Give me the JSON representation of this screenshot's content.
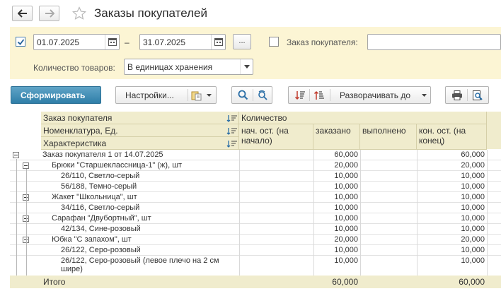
{
  "window": {
    "title": "Заказы покупателей"
  },
  "filters": {
    "period_enabled": true,
    "date_from": "01.07.2025",
    "date_dash": "–",
    "date_to": "31.07.2025",
    "period_button": "...",
    "order_enabled": false,
    "order_label": "Заказ покупателя:",
    "order_value": "",
    "qty_label": "Количество товаров:",
    "qty_value": "В единицах хранения"
  },
  "toolbar": {
    "generate": "Сформировать",
    "settings": "Настройки...",
    "expand": "Разворачивать до"
  },
  "report": {
    "headers": {
      "group1": "Заказ покупателя",
      "group2": "Номенклатура, Ед.",
      "group3": "Характеристика",
      "quantity": "Количество",
      "start_1": "нач. ост. (на",
      "start_2": "начало)",
      "ordered": "заказано",
      "done": "выполнено",
      "end_1": "кон. ост. (на",
      "end_2": "конец)"
    },
    "rows": [
      {
        "name": "Заказ покупателя 1 от 14.07.2025",
        "start": "",
        "ordered": "60,000",
        "done": "",
        "end": "60,000"
      },
      {
        "name": "Брюки \"Старшеклассница-1\" (ж), шт",
        "start": "",
        "ordered": "20,000",
        "done": "",
        "end": "20,000"
      },
      {
        "name": "26/110, Светло-серый",
        "start": "",
        "ordered": "10,000",
        "done": "",
        "end": "10,000"
      },
      {
        "name": "56/188, Темно-серый",
        "start": "",
        "ordered": "10,000",
        "done": "",
        "end": "10,000"
      },
      {
        "name": "Жакет \"Школьница\", шт",
        "start": "",
        "ordered": "10,000",
        "done": "",
        "end": "10,000"
      },
      {
        "name": "34/116, Светло-серый",
        "start": "",
        "ordered": "10,000",
        "done": "",
        "end": "10,000"
      },
      {
        "name": "Сарафан \"Двубортный\", шт",
        "start": "",
        "ordered": "10,000",
        "done": "",
        "end": "10,000"
      },
      {
        "name": "42/134, Сине-розовый",
        "start": "",
        "ordered": "10,000",
        "done": "",
        "end": "10,000"
      },
      {
        "name": "Юбка \"С запахом\", шт",
        "start": "",
        "ordered": "20,000",
        "done": "",
        "end": "20,000"
      },
      {
        "name": "26/122, Серо-розовый",
        "start": "",
        "ordered": "10,000",
        "done": "",
        "end": "10,000"
      },
      {
        "name_1": "26/122, Серо-розовый (левое плечо на 2 см",
        "name_2": "шире)",
        "start": "",
        "ordered": "10,000",
        "done": "",
        "end": "10,000"
      }
    ],
    "total": {
      "label": "Итого",
      "start": "",
      "ordered": "60,000",
      "done": "",
      "end": "60,000"
    }
  },
  "colors": {
    "filter_bg": "#fcf5d4",
    "header_bg": "#f0eccd",
    "primary_button": "#3a88b2"
  }
}
